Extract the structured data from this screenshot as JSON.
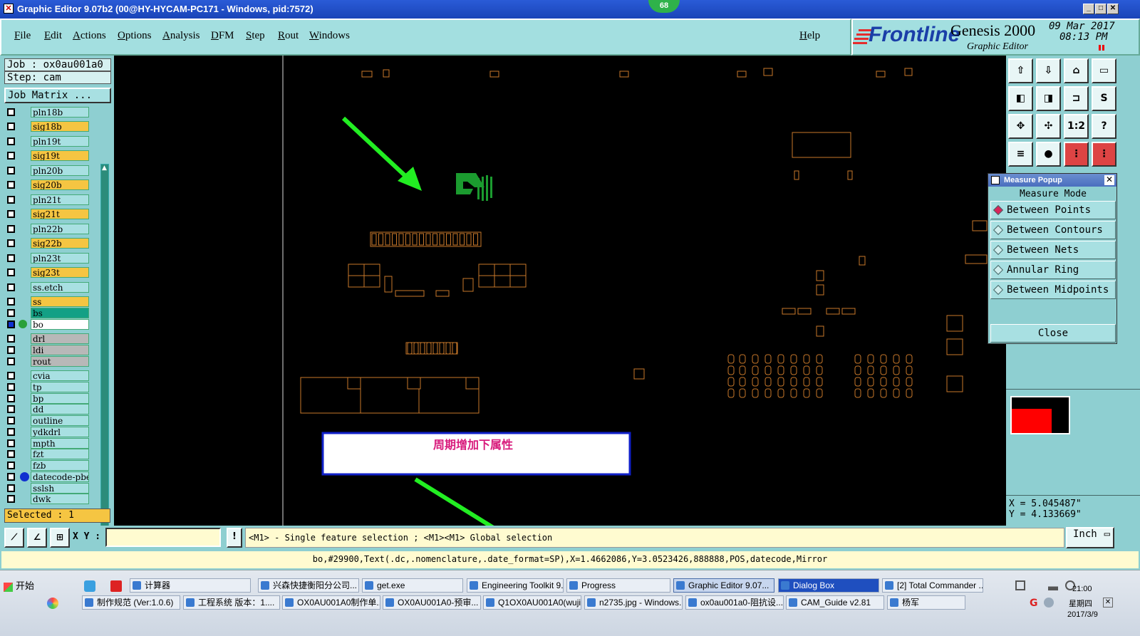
{
  "window": {
    "title": "Graphic Editor 9.07b2 (00@HY-HYCAM-PC171 - Windows, pid:7572)",
    "badge": "68"
  },
  "menu": [
    "File",
    "Edit",
    "Actions",
    "Options",
    "Analysis",
    "DFM",
    "Step",
    "Rout",
    "Windows"
  ],
  "help_label": "Help",
  "logo": {
    "brand": "Frontline",
    "product": "Genesis 2000",
    "subtitle": "Graphic Editor",
    "date": "09 Mar 2017",
    "time": "08:13 PM"
  },
  "job": {
    "job_line": "Job : ox0au001a0",
    "step_line": "Step: cam",
    "matrix_button": "Job Matrix ..."
  },
  "layers": [
    {
      "name": "pln18b",
      "color": "#a8e0e2"
    },
    {
      "name": "sig18b",
      "color": "#f5c542"
    },
    {
      "name": "pln19t",
      "color": "#a8e0e2"
    },
    {
      "name": "sig19t",
      "color": "#f5c542"
    },
    {
      "name": "pln20b",
      "color": "#a8e0e2"
    },
    {
      "name": "sig20b",
      "color": "#f5c542"
    },
    {
      "name": "pln21t",
      "color": "#a8e0e2"
    },
    {
      "name": "sig21t",
      "color": "#f5c542"
    },
    {
      "name": "pln22b",
      "color": "#a8e0e2"
    },
    {
      "name": "sig22b",
      "color": "#f5c542"
    },
    {
      "name": "pln23t",
      "color": "#a8e0e2"
    },
    {
      "name": "sig23t",
      "color": "#f5c542"
    },
    {
      "name": "ss.etch",
      "color": "#a8e0e2"
    },
    {
      "name": "ss",
      "color": "#f5c542"
    },
    {
      "name": "bs",
      "color": "#13a085"
    },
    {
      "name": "bo",
      "color": "#ffffff"
    },
    {
      "name": "drl",
      "color": "#b8b8b8"
    },
    {
      "name": "ldi",
      "color": "#b8b8b8"
    },
    {
      "name": "rout",
      "color": "#b8b8b8"
    },
    {
      "name": "cvia",
      "color": "#a8e0e2"
    },
    {
      "name": "tp",
      "color": "#a8e0e2"
    },
    {
      "name": "bp",
      "color": "#a8e0e2"
    },
    {
      "name": "dd",
      "color": "#a8e0e2"
    },
    {
      "name": "outline",
      "color": "#a8e0e2"
    },
    {
      "name": "ydkdrl",
      "color": "#a8e0e2"
    },
    {
      "name": "mpth",
      "color": "#a8e0e2"
    },
    {
      "name": "fzt",
      "color": "#a8e0e2"
    },
    {
      "name": "fzb",
      "color": "#a8e0e2"
    },
    {
      "name": "datecode-pbe",
      "color": "#a8e0e2"
    },
    {
      "name": "sslsh",
      "color": "#a8e0e2"
    },
    {
      "name": "dwk",
      "color": "#a8e0e2"
    }
  ],
  "selected_label": "Selected : 1",
  "measure": {
    "title": "Measure Popup",
    "mode_label": "Measure Mode",
    "options": [
      "Between Points",
      "Between Contours",
      "Between Nets",
      "Annular Ring",
      "Between Midpoints"
    ],
    "selected_index": 0,
    "close_label": "Close"
  },
  "coords": {
    "x": "X = 5.045487\"",
    "y": "Y = 4.133669\""
  },
  "annotation_text": "周期增加下属性",
  "command": {
    "xy_label": "X Y :",
    "hint": "<M1> - Single feature selection ; <M1><M1> Global selection",
    "units": "Inch"
  },
  "status_line": "bo,#29900,Text(.dc,.nomenclature,.date_format=SP),X=1.4662086,Y=3.0523426,888888,POS,datecode,Mirror",
  "taskbar": {
    "start": "开始",
    "row1": [
      "计算器",
      "兴森快捷衡阳分公司...",
      "get.exe",
      "Engineering Toolkit 9....",
      "Progress",
      "Graphic Editor 9.07...",
      "Dialog Box",
      "[2] Total Commander ..."
    ],
    "row2": [
      "制作规范 (Ver:1.0.6)",
      "工程系统  版本：1....",
      "OX0AU001A0制作单...",
      "OX0AU001A0-预审...",
      "Q1OX0AU001A0(wuji...",
      "n2735.jpg - Windows...",
      "ox0au001a0-阻抗设...",
      "CAM_Guide v2.81",
      "杨军"
    ],
    "clock": "21:00",
    "weekday": "星期四",
    "date": "2017/3/9"
  },
  "colors": {
    "panel": "#8ecfd1",
    "accent": "#a3dfe0",
    "trace": "#c8782a",
    "arrow": "#22ee22"
  }
}
